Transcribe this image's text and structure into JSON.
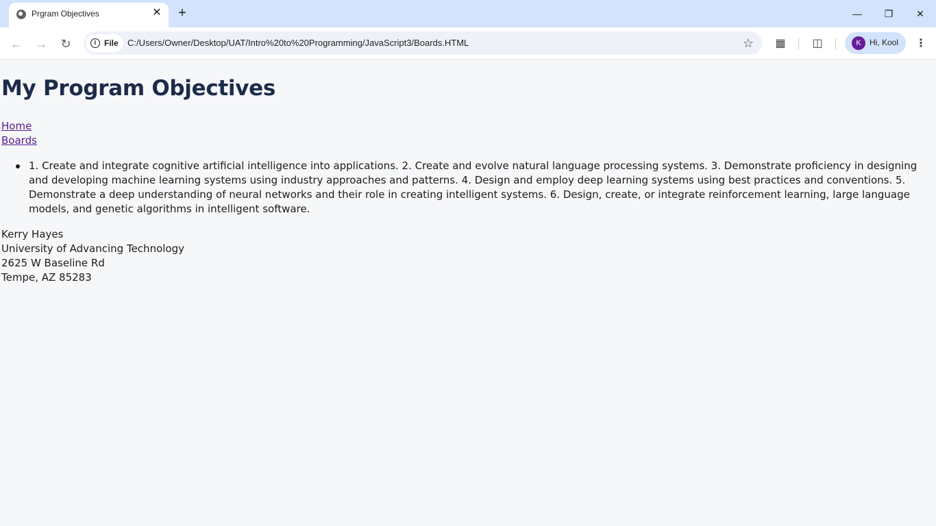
{
  "browser": {
    "tab_title": "Prgram Objectives",
    "tab_close": "✕",
    "new_tab": "+",
    "url": "C:/Users/Owner/Desktop/UAT/Intro%20to%20Programming/JavaScript3/Boards.HTML",
    "site_chip_label": "File",
    "profile_initial": "K",
    "profile_label": "Hi, Kool",
    "icons": [
      "globe-icon",
      "back-icon",
      "forward-icon",
      "reload-icon",
      "info-icon",
      "star-icon",
      "extensions-icon",
      "cast-icon",
      "menu-icon",
      "minimize-icon",
      "restore-icon",
      "close-icon"
    ],
    "accent_color": "#d3e3fd",
    "avatar_color": "#6a1b9a"
  },
  "page": {
    "heading": "My Program Objectives",
    "nav_links": [
      "Home",
      "Boards"
    ],
    "objectives": "1. Create and integrate cognitive artificial intelligence into applications. 2. Create and evolve natural language processing systems. 3. Demonstrate proficiency in designing and developing machine learning systems using industry approaches and patterns. 4. Design and employ deep learning systems using best practices and conventions. 5. Demonstrate a deep understanding of neural networks and their role in creating intelligent systems. 6. Design, create, or integrate reinforcement learning, large language models, and genetic algorithms in intelligent software.",
    "address": {
      "name": "Kerry Hayes",
      "org": "University of Advancing Technology",
      "street": "2625 W Baseline Rd",
      "city": "Tempe, AZ 85283"
    },
    "heading_color": "#1c2b4a",
    "link_color": "#551a8b"
  }
}
